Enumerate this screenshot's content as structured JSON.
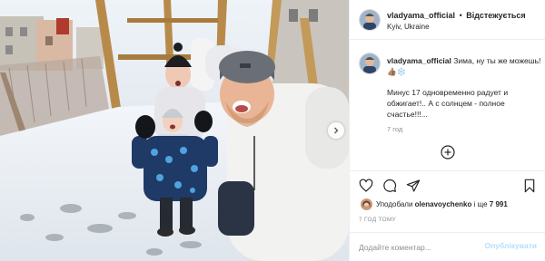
{
  "header": {
    "username": "vladyama_official",
    "separator": "•",
    "follow_status": "Відстежується",
    "location": "Kyiv, Ukraine"
  },
  "caption": {
    "username": "vladyama_official",
    "headline": "Зима, ну ты же можешь! 👍🏽❄️",
    "body": "Минус 17 одновременно радует и обжигает!.. А с солнцем - полное счастье!!!...",
    "time": "7 год"
  },
  "actions": {
    "icons": [
      "heart-icon",
      "comment-icon",
      "share-icon",
      "bookmark-icon"
    ]
  },
  "likes": {
    "prefix": "Уподобали",
    "user": "olenavoychenko",
    "middle": "і ще",
    "count": "7 991"
  },
  "post_time": "7 ГОД ТОМУ",
  "comment": {
    "placeholder": "Додайте коментар...",
    "publish_label": "Опублікувати"
  },
  "colors": {
    "accent_light": "#b2dffc",
    "muted": "#8e8e8e",
    "verified": "#3897f0"
  }
}
